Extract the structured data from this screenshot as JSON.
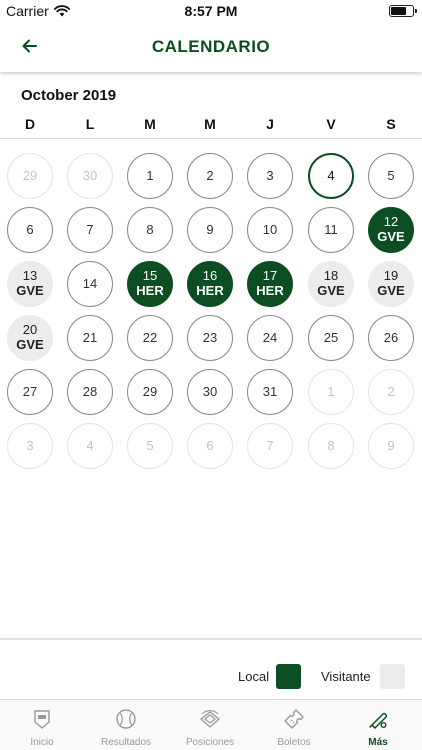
{
  "status_bar": {
    "carrier": "Carrier",
    "time": "8:57 PM"
  },
  "header": {
    "title": "CALENDARIO"
  },
  "calendar": {
    "month_label": "October 2019",
    "weekdays": [
      "D",
      "L",
      "M",
      "M",
      "J",
      "V",
      "S"
    ],
    "weeks": [
      [
        {
          "day": "29",
          "type": "muted"
        },
        {
          "day": "30",
          "type": "muted"
        },
        {
          "day": "1",
          "type": "normal"
        },
        {
          "day": "2",
          "type": "normal"
        },
        {
          "day": "3",
          "type": "normal"
        },
        {
          "day": "4",
          "type": "today"
        },
        {
          "day": "5",
          "type": "normal"
        }
      ],
      [
        {
          "day": "6",
          "type": "normal"
        },
        {
          "day": "7",
          "type": "normal"
        },
        {
          "day": "8",
          "type": "normal"
        },
        {
          "day": "9",
          "type": "normal"
        },
        {
          "day": "10",
          "type": "normal"
        },
        {
          "day": "11",
          "type": "normal"
        },
        {
          "day": "12",
          "type": "local",
          "team": "GVE"
        }
      ],
      [
        {
          "day": "13",
          "type": "visit",
          "team": "GVE"
        },
        {
          "day": "14",
          "type": "normal"
        },
        {
          "day": "15",
          "type": "local",
          "team": "HER"
        },
        {
          "day": "16",
          "type": "local",
          "team": "HER"
        },
        {
          "day": "17",
          "type": "local",
          "team": "HER"
        },
        {
          "day": "18",
          "type": "visit",
          "team": "GVE"
        },
        {
          "day": "19",
          "type": "visit",
          "team": "GVE"
        }
      ],
      [
        {
          "day": "20",
          "type": "visit",
          "team": "GVE"
        },
        {
          "day": "21",
          "type": "normal"
        },
        {
          "day": "22",
          "type": "normal"
        },
        {
          "day": "23",
          "type": "normal"
        },
        {
          "day": "24",
          "type": "normal"
        },
        {
          "day": "25",
          "type": "normal"
        },
        {
          "day": "26",
          "type": "normal"
        }
      ],
      [
        {
          "day": "27",
          "type": "normal"
        },
        {
          "day": "28",
          "type": "normal"
        },
        {
          "day": "29",
          "type": "normal"
        },
        {
          "day": "30",
          "type": "normal"
        },
        {
          "day": "31",
          "type": "normal"
        },
        {
          "day": "1",
          "type": "muted"
        },
        {
          "day": "2",
          "type": "muted"
        }
      ],
      [
        {
          "day": "3",
          "type": "muted"
        },
        {
          "day": "4",
          "type": "muted"
        },
        {
          "day": "5",
          "type": "muted"
        },
        {
          "day": "6",
          "type": "muted"
        },
        {
          "day": "7",
          "type": "muted"
        },
        {
          "day": "8",
          "type": "muted"
        },
        {
          "day": "9",
          "type": "muted"
        }
      ]
    ]
  },
  "legend": {
    "local_label": "Local",
    "visit_label": "Visitante"
  },
  "colors": {
    "brand_green": "#0d4d22",
    "visit_gray": "#ececec"
  },
  "tabbar": {
    "items": [
      {
        "label": "Inicio",
        "icon": "home-plate-base-icon",
        "active": false
      },
      {
        "label": "Resultados",
        "icon": "baseball-icon",
        "active": false
      },
      {
        "label": "Posiciones",
        "icon": "stadium-icon",
        "active": false
      },
      {
        "label": "Boletos",
        "icon": "ticket-icon",
        "active": false
      },
      {
        "label": "Más",
        "icon": "bat-and-ball-icon",
        "active": true
      }
    ]
  }
}
